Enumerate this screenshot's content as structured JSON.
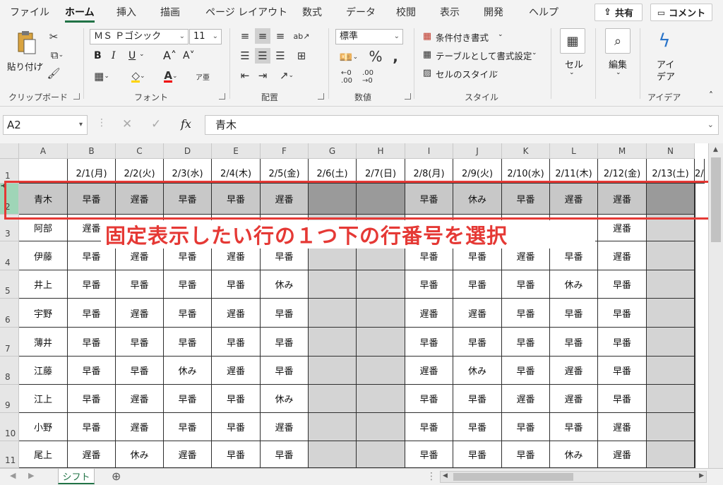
{
  "ribbon_tabs": [
    "ファイル",
    "ホーム",
    "挿入",
    "描画",
    "ページ レイアウト",
    "数式",
    "データ",
    "校閲",
    "表示",
    "開発",
    "ヘルプ"
  ],
  "share_label": "共有",
  "comment_label": "コメント",
  "clipboard": {
    "paste_label": "貼り付け",
    "group_label": "クリップボード"
  },
  "font": {
    "name": "ＭＳ Ｐゴシック",
    "size": "11",
    "group_label": "フォント",
    "bold": "B",
    "italic": "I",
    "underline": "U"
  },
  "alignment": {
    "group_label": "配置"
  },
  "number": {
    "format": "標準",
    "group_label": "数値"
  },
  "styles": {
    "conditional": "条件付き書式",
    "table": "テーブルとして書式設定",
    "cell_style": "セルのスタイル",
    "group_label": "スタイル"
  },
  "cells": {
    "label": "セル"
  },
  "editing": {
    "label": "編集"
  },
  "ideas": {
    "label_line1": "アイ",
    "label_line2": "デア",
    "group_label": "アイデア"
  },
  "formula_bar": {
    "name_box": "A2",
    "fx": "fx",
    "value": "青木"
  },
  "columns": [
    "A",
    "B",
    "C",
    "D",
    "E",
    "F",
    "G",
    "H",
    "I",
    "J",
    "K",
    "L",
    "M",
    "N"
  ],
  "header_dates": [
    "2/1(月)",
    "2/2(火)",
    "2/3(水)",
    "2/4(木)",
    "2/5(金)",
    "2/6(土)",
    "2/7(日)",
    "2/8(月)",
    "2/9(火)",
    "2/10(水)",
    "2/11(木)",
    "2/12(金)",
    "2/13(土)",
    "2/"
  ],
  "weekend_columns": [
    5,
    6,
    12,
    13
  ],
  "rows": [
    {
      "num": "2",
      "name": "青木",
      "shifts": [
        "早番",
        "遅番",
        "早番",
        "早番",
        "遅番",
        "",
        "",
        "早番",
        "休み",
        "早番",
        "遅番",
        "遅番",
        "",
        ""
      ]
    },
    {
      "num": "3",
      "name": "阿部",
      "shifts": [
        "遅番",
        "",
        "",
        "",
        "",
        "",
        "",
        "",
        "",
        "",
        "",
        "遅番",
        "",
        ""
      ]
    },
    {
      "num": "4",
      "name": "伊藤",
      "shifts": [
        "早番",
        "遅番",
        "早番",
        "遅番",
        "早番",
        "",
        "",
        "早番",
        "早番",
        "遅番",
        "早番",
        "遅番",
        "",
        ""
      ]
    },
    {
      "num": "5",
      "name": "井上",
      "shifts": [
        "早番",
        "早番",
        "早番",
        "早番",
        "休み",
        "",
        "",
        "早番",
        "早番",
        "早番",
        "休み",
        "早番",
        "",
        ""
      ]
    },
    {
      "num": "6",
      "name": "宇野",
      "shifts": [
        "早番",
        "遅番",
        "早番",
        "遅番",
        "早番",
        "",
        "",
        "遅番",
        "遅番",
        "早番",
        "早番",
        "早番",
        "",
        ""
      ]
    },
    {
      "num": "7",
      "name": "薄井",
      "shifts": [
        "早番",
        "早番",
        "早番",
        "早番",
        "早番",
        "",
        "",
        "早番",
        "早番",
        "早番",
        "早番",
        "早番",
        "",
        ""
      ]
    },
    {
      "num": "8",
      "name": "江藤",
      "shifts": [
        "早番",
        "早番",
        "休み",
        "遅番",
        "早番",
        "",
        "",
        "遅番",
        "休み",
        "早番",
        "遅番",
        "早番",
        "",
        ""
      ]
    },
    {
      "num": "9",
      "name": "江上",
      "shifts": [
        "早番",
        "遅番",
        "早番",
        "早番",
        "休み",
        "",
        "",
        "早番",
        "早番",
        "遅番",
        "遅番",
        "早番",
        "",
        ""
      ]
    },
    {
      "num": "10",
      "name": "小野",
      "shifts": [
        "早番",
        "遅番",
        "早番",
        "早番",
        "遅番",
        "",
        "",
        "早番",
        "早番",
        "早番",
        "早番",
        "遅番",
        "",
        ""
      ]
    },
    {
      "num": "11",
      "name": "尾上",
      "shifts": [
        "遅番",
        "休み",
        "遅番",
        "早番",
        "早番",
        "",
        "",
        "早番",
        "早番",
        "早番",
        "休み",
        "遅番",
        "",
        ""
      ]
    }
  ],
  "annotation": "固定表示したい行の１つ下の行番号を選択",
  "sheet_tab": "シフト",
  "colors": {
    "accent": "#217346",
    "annotation": "#e53935",
    "selection_row_header": "#9fd5b7"
  }
}
